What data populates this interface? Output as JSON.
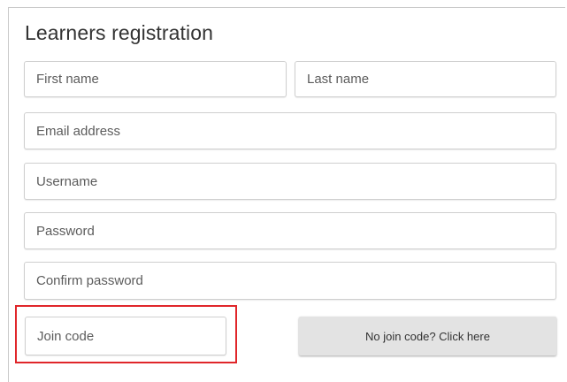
{
  "form": {
    "title": "Learners registration",
    "fields": {
      "first_name": "First name",
      "last_name": "Last name",
      "email": "Email address",
      "username": "Username",
      "password": "Password",
      "confirm_password": "Confirm password",
      "join_code": "Join code"
    },
    "no_join_code_button": "No join code? Click here"
  },
  "colors": {
    "highlight": "#e0262a",
    "button_bg": "#e3e3e3"
  }
}
